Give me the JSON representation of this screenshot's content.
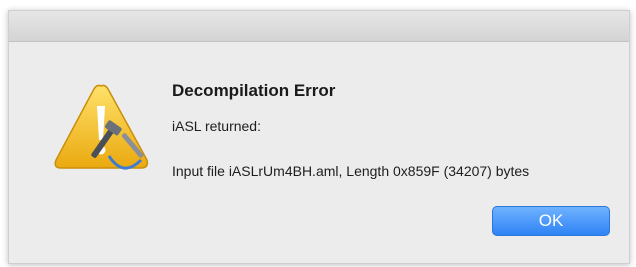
{
  "dialog": {
    "title": "Decompilation Error",
    "message_line1": "iASL returned:",
    "message_line2": "Input file iASLrUm4BH.aml, Length 0x859F (34207) bytes",
    "ok_label": "OK",
    "icon": "warning-triangle-with-tools-icon"
  },
  "colors": {
    "dialog_bg": "#ececec",
    "ok_button": "#2f83f5",
    "warning_yellow": "#f5c518"
  }
}
